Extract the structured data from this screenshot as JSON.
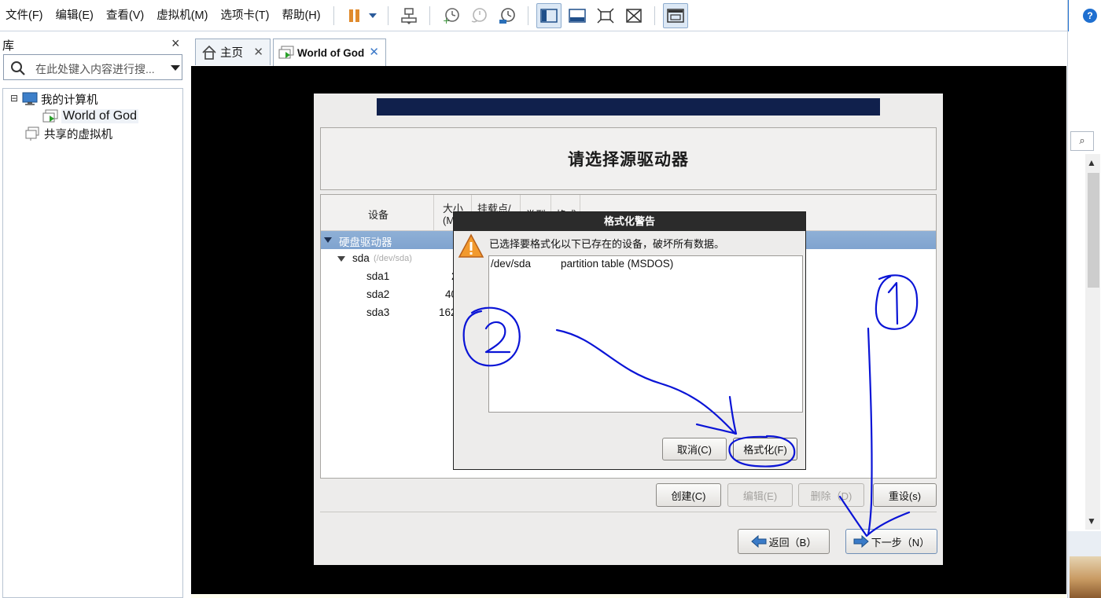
{
  "menubar": {
    "items": [
      "文件(F)",
      "编辑(E)",
      "查看(V)",
      "虚拟机(M)",
      "选项卡(T)",
      "帮助(H)"
    ]
  },
  "toolbar": {
    "icons": [
      "pause-icon",
      "dropdown-arrow-icon",
      "network-icon",
      "snapshot-take-icon",
      "snapshot-revert-icon",
      "snapshot-manager-icon",
      "view-console-icon",
      "view-fullscreen-icon",
      "view-stretch-icon",
      "view-unity-icon",
      "thumbnail-icon"
    ]
  },
  "library": {
    "title": "库",
    "close": "×",
    "search_placeholder": "在此处键入内容进行搜...",
    "tree": {
      "my_computer": "我的计算机",
      "vm": "World of God",
      "shared": "共享的虚拟机",
      "expander": "⊟"
    }
  },
  "tabs": [
    {
      "label": "主页",
      "close": "✕",
      "icon": "home-icon"
    },
    {
      "label": "World of God",
      "close": "✕",
      "icon": "vm-icon"
    }
  ],
  "installer": {
    "title": "请选择源驱动器",
    "columns": {
      "device": "设备",
      "size_1": "大小",
      "size_2": "(M",
      "mount_1": "挂载点/",
      "type": "类型",
      "format": "格式"
    },
    "rows": {
      "hard_drives": "硬盘驱动器",
      "sda": "sda",
      "sda_path": "(/dev/sda)",
      "sda1": "sda1",
      "sda1_size": "2",
      "sda2": "sda2",
      "sda2_size": "40",
      "sda3": "sda3",
      "sda3_size": "162"
    },
    "buttons": {
      "create": "创建(C)",
      "edit": "编辑(E)",
      "delete": "删除（D)",
      "reset": "重设(s)",
      "back": "返回（B）",
      "next": "下一步（N）"
    }
  },
  "dialog": {
    "title": "格式化警告",
    "message": "已选择要格式化以下已存在的设备，破坏所有数据。",
    "device": "/dev/sda",
    "description": "partition table (MSDOS)",
    "cancel": "取消(C)",
    "format": "格式化(F)"
  },
  "rightpane": {
    "help": "?",
    "search": "⌕",
    "scroll_up": "▲",
    "scroll_down": "▼"
  },
  "colors": {
    "accent": "#1e6fd0",
    "banner": "#10204c",
    "highlight_row": "#7fa3cf",
    "annotation_ink": "#0a14d6",
    "vm_background": "#000000"
  }
}
